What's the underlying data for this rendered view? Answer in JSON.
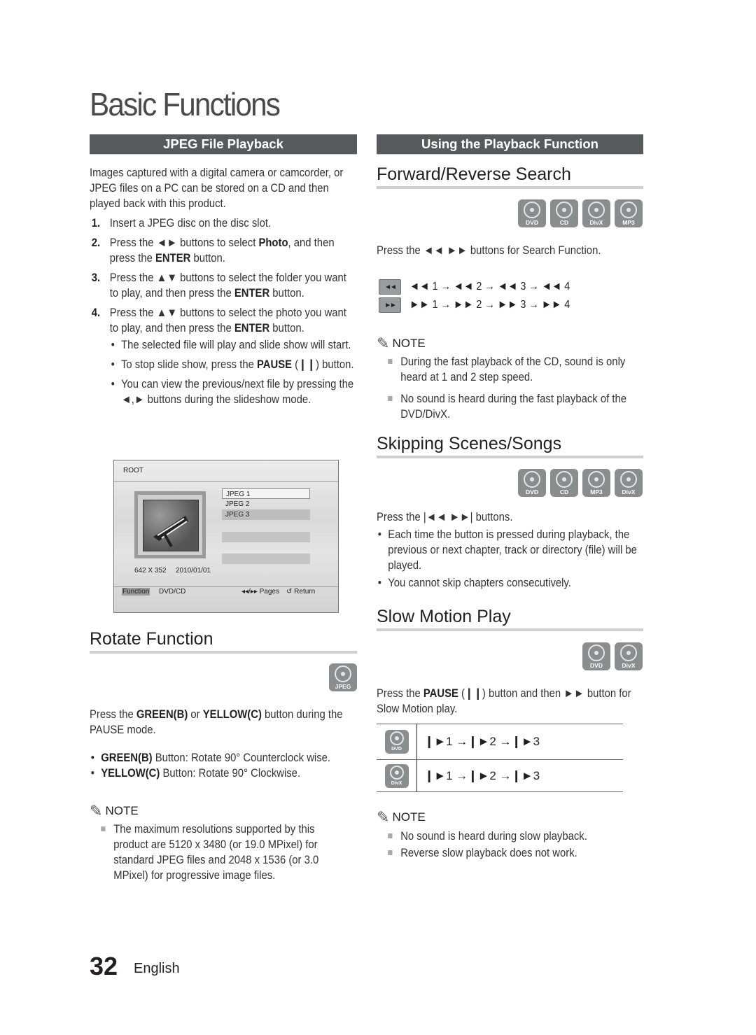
{
  "page_title": "Basic Functions",
  "left": {
    "bar_title": "JPEG File Playback",
    "intro": "Images captured with a digital camera or camcorder, or JPEG files on a PC can be stored on a CD and then played back with this product.",
    "steps": [
      {
        "num": "1.",
        "pre": "Insert a JPEG disc on the disc slot.",
        "b1": "",
        "mid": "",
        "b2": "",
        "post": ""
      },
      {
        "num": "2.",
        "pre": "Press the ◄► buttons to select ",
        "b1": "Photo",
        "mid": ", and then press the ",
        "b2": "ENTER",
        "post": " button."
      },
      {
        "num": "3.",
        "pre": "Press the ▲▼ buttons to select the folder you want to play, and then press the ",
        "b1": "ENTER",
        "mid": " button.",
        "b2": "",
        "post": ""
      },
      {
        "num": "4.",
        "pre": "Press the ▲▼ buttons to select the photo you want to play, and then press the ",
        "b1": "ENTER",
        "mid": " button.",
        "b2": "",
        "post": ""
      }
    ],
    "step4_bullets": [
      {
        "pre": "The selected file will play and slide show will start.",
        "b": "",
        "post": ""
      },
      {
        "pre": "To stop slide show, press the ",
        "b": "PAUSE",
        "post": " (❙❙) button."
      },
      {
        "pre": "You can view the previous/next file by pressing the ◄,► buttons during the slideshow mode.",
        "b": "",
        "post": ""
      }
    ],
    "osd": {
      "root_label": "ROOT",
      "files": [
        "JPEG 1",
        "JPEG 2",
        "JPEG 3"
      ],
      "resolution": "642 X 352",
      "date": "2010/01/01",
      "function_label": "Function",
      "source_label": "DVD/CD",
      "pages_label": "◂◂/▸▸ Pages",
      "return_label": "↺ Return"
    },
    "rotate": {
      "heading": "Rotate Function",
      "disc_icons": [
        "JPEG"
      ],
      "desc_pre": "Press the ",
      "desc_b1": "GREEN(B)",
      "desc_mid": " or ",
      "desc_b2": "YELLOW(C)",
      "desc_post": " button during the PAUSE mode.",
      "bullets": [
        {
          "b": "GREEN(B)",
          "text": " Button: Rotate 90° Counterclock wise."
        },
        {
          "b": "YELLOW(C)",
          "text": " Button: Rotate 90° Clockwise."
        }
      ],
      "note_label": "NOTE",
      "notes": [
        "The maximum resolutions supported by this product are 5120 x 3480 (or 19.0 MPixel) for standard JPEG files and 2048 x 1536 (or 3.0 MPixel) for progressive image files."
      ]
    }
  },
  "right": {
    "bar_title": "Using the Playback Function",
    "search": {
      "heading": "Forward/Reverse Search",
      "disc_icons": [
        "DVD",
        "CD",
        "DivX",
        "MP3"
      ],
      "desc": "Press the ◄◄ ►► buttons for Search Function.",
      "rows": [
        {
          "button": "◄◄",
          "sequence": "◄◄ 1 → ◄◄ 2 → ◄◄ 3 → ◄◄ 4"
        },
        {
          "button": "►►",
          "sequence": "►► 1 → ►► 2 → ►► 3 → ►► 4"
        }
      ],
      "note_label": "NOTE",
      "notes": [
        "During the fast playback of the CD, sound is only heard at 1 and 2 step speed.",
        "No sound is heard during the fast playback of the DVD/DivX."
      ]
    },
    "skip": {
      "heading": "Skipping Scenes/Songs",
      "disc_icons": [
        "DVD",
        "CD",
        "MP3",
        "DivX"
      ],
      "desc": "Press the |◄◄ ►►| buttons.",
      "bullets": [
        "Each time the button is pressed during playback, the previous or next chapter, track or directory (file) will be played.",
        "You cannot skip chapters consecutively."
      ]
    },
    "slow": {
      "heading": "Slow Motion Play",
      "disc_icons": [
        "DVD",
        "DivX"
      ],
      "desc_pre": "Press the ",
      "desc_b": "PAUSE",
      "desc_post": " (❙❙) button and then ►► button for Slow Motion play.",
      "rows": [
        {
          "disc": "DVD",
          "sequence": "❙►1 →❙►2 →❙►3"
        },
        {
          "disc": "DivX",
          "sequence": "❙►1 →❙►2 →❙►3"
        }
      ],
      "note_label": "NOTE",
      "notes": [
        "No sound is heard during slow playback.",
        "Reverse slow playback does not work."
      ]
    }
  },
  "footer": {
    "page_number": "32",
    "language": "English"
  }
}
